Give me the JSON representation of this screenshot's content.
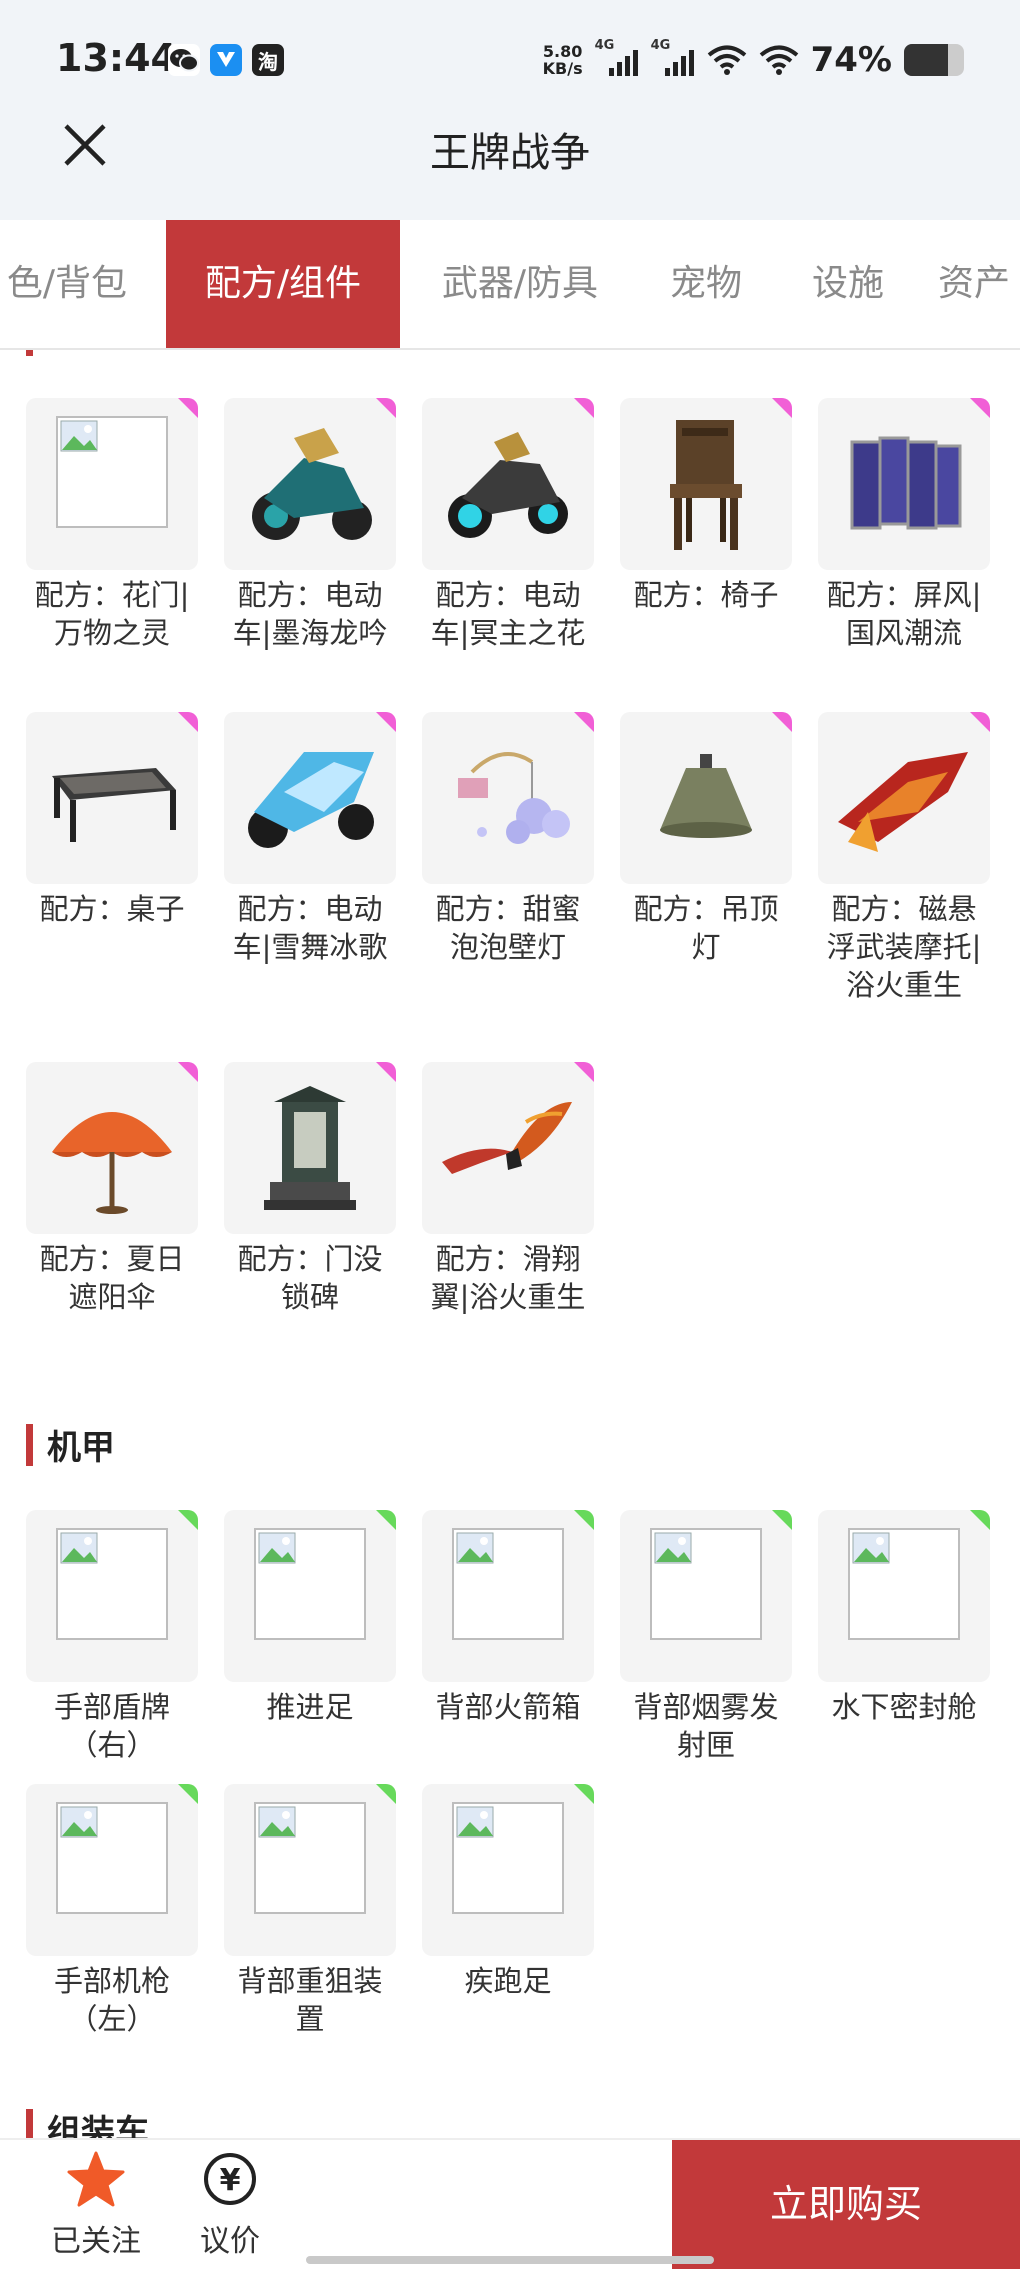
{
  "status_bar": {
    "time": "13:44",
    "net_speed_value": "5.80",
    "net_speed_unit": "KB/s",
    "signal_1_label": "4G",
    "signal_2_label": "4G",
    "battery_pct": "74%",
    "battery_level": 0.74,
    "app_icons": [
      "wechat-icon",
      "app-icon",
      "taobao-icon"
    ],
    "taobao_glyph": "淘"
  },
  "nav": {
    "title": "王牌战争"
  },
  "tabs": [
    {
      "label": "色/背包"
    },
    {
      "label": "配方/组件",
      "active": true
    },
    {
      "label": "武器/防具"
    },
    {
      "label": "宠物"
    },
    {
      "label": "设施"
    },
    {
      "label": "资产"
    }
  ],
  "sections": {
    "recipes": {
      "items": [
        {
          "label": "配方：花门|万物之灵",
          "image": "placeholder"
        },
        {
          "label": "配方：电动车|墨海龙吟",
          "image": "motorcycle-teal"
        },
        {
          "label": "配方：电动车|冥主之花",
          "image": "motorcycle-cyan"
        },
        {
          "label": "配方：椅子",
          "image": "chair"
        },
        {
          "label": "配方：屏风|国风潮流",
          "image": "screen"
        },
        {
          "label": "配方：桌子",
          "image": "table"
        },
        {
          "label": "配方：电动车|雪舞冰歌",
          "image": "motorcycle-ice"
        },
        {
          "label": "配方：甜蜜泡泡壁灯",
          "image": "bubble-lamp"
        },
        {
          "label": "配方：吊顶灯",
          "image": "ceiling-lamp"
        },
        {
          "label": "配方：磁悬浮武装摩托|浴火重生",
          "image": "hover-bike"
        },
        {
          "label": "配方：夏日遮阳伞",
          "image": "umbrella"
        },
        {
          "label": "配方：门没锁碑",
          "image": "stele"
        },
        {
          "label": "配方：滑翔翼|浴火重生",
          "image": "glider"
        }
      ]
    },
    "mecha": {
      "title": "机甲",
      "items": [
        {
          "label": "手部盾牌（右）"
        },
        {
          "label": "推进足"
        },
        {
          "label": "背部火箭箱"
        },
        {
          "label": "背部烟雾发射匣"
        },
        {
          "label": "水下密封舱"
        },
        {
          "label": "手部机枪（左）"
        },
        {
          "label": "背部重狙装置"
        },
        {
          "label": "疾跑足"
        }
      ]
    },
    "assembly": {
      "title": "组装车"
    }
  },
  "bottom_bar": {
    "follow_label": "已关注",
    "bargain_label": "议价",
    "bargain_glyph": "¥",
    "buy_label": "立即购买"
  },
  "colors": {
    "accent": "#c2393a",
    "recipe_corner": "#f15fd6",
    "mecha_corner": "#67d95b",
    "follow_star": "#f05a28"
  }
}
